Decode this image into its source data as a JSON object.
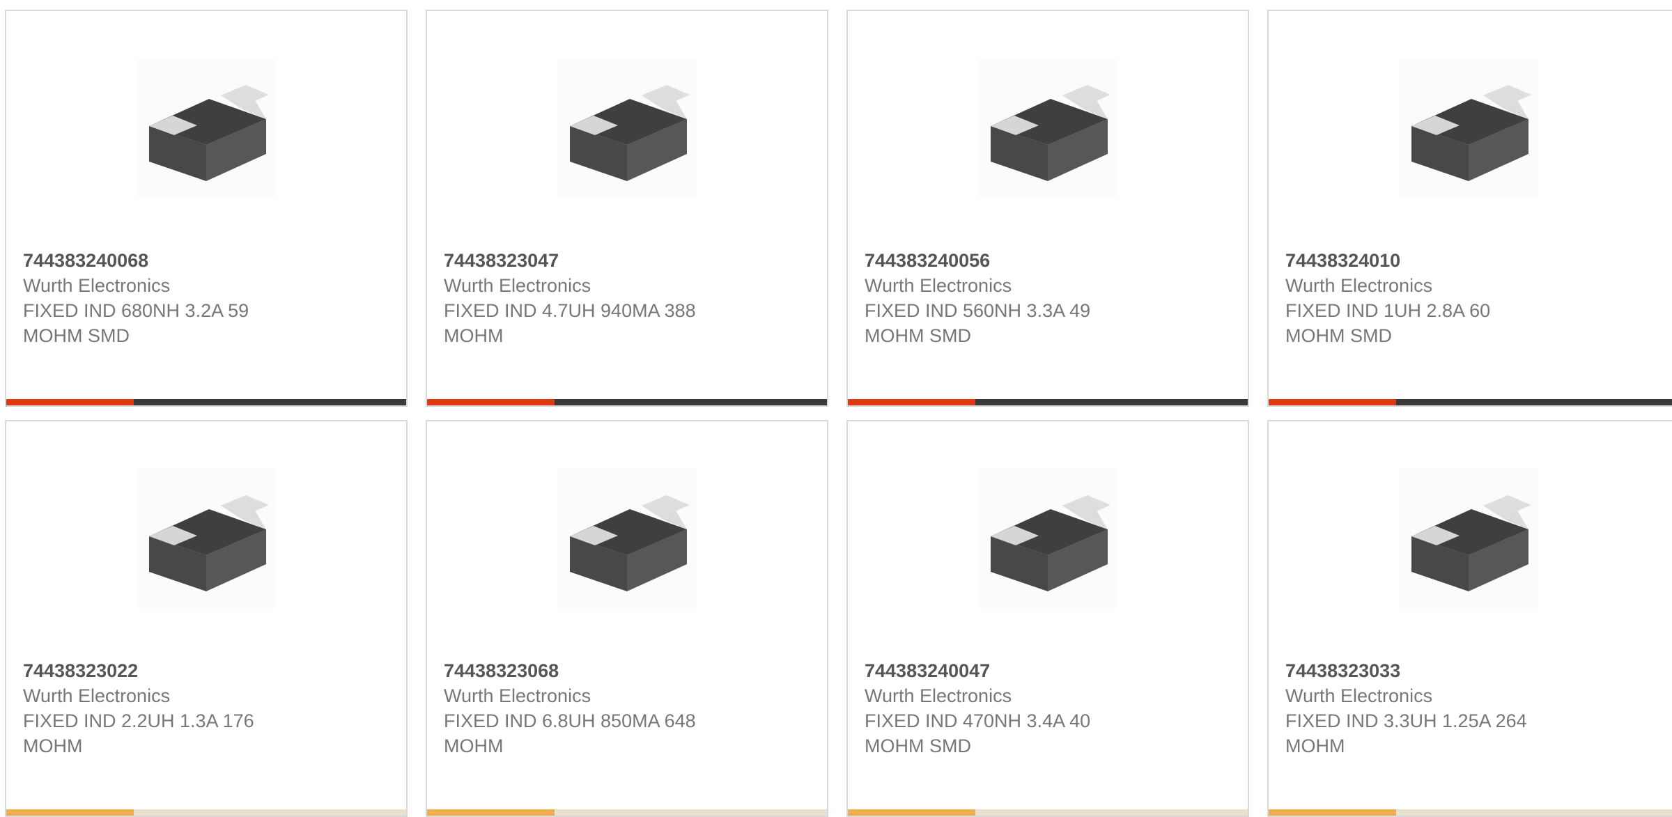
{
  "theme": {
    "accent": "#e1390f",
    "bar_dark": "#3a3a3a",
    "border": "#d9d9d9",
    "text": "#777777"
  },
  "products": [
    {
      "part_number": "744383240068",
      "manufacturer": "Wurth Electronics",
      "description": "FIXED IND 680NH 3.2A 59 MOHM SMD",
      "image_icon": "smd-inductor-image"
    },
    {
      "part_number": "74438323047",
      "manufacturer": "Wurth Electronics",
      "description": "FIXED IND 4.7UH 940MA 388 MOHM",
      "image_icon": "smd-inductor-image"
    },
    {
      "part_number": "744383240056",
      "manufacturer": "Wurth Electronics",
      "description": "FIXED IND 560NH 3.3A 49 MOHM SMD",
      "image_icon": "smd-inductor-image"
    },
    {
      "part_number": "74438324010",
      "manufacturer": "Wurth Electronics",
      "description": "FIXED IND 1UH 2.8A 60 MOHM SMD",
      "image_icon": "smd-inductor-image"
    },
    {
      "part_number": "74438323022",
      "manufacturer": "Wurth Electronics",
      "description": "FIXED IND 2.2UH 1.3A 176 MOHM",
      "image_icon": "smd-inductor-image"
    },
    {
      "part_number": "74438323068",
      "manufacturer": "Wurth Electronics",
      "description": "FIXED IND 6.8UH 850MA 648 MOHM",
      "image_icon": "smd-inductor-image"
    },
    {
      "part_number": "744383240047",
      "manufacturer": "Wurth Electronics",
      "description": "FIXED IND 470NH 3.4A 40 MOHM SMD",
      "image_icon": "smd-inductor-image"
    },
    {
      "part_number": "74438323033",
      "manufacturer": "Wurth Electronics",
      "description": "FIXED IND 3.3UH 1.25A 264 MOHM",
      "image_icon": "smd-inductor-image"
    }
  ]
}
